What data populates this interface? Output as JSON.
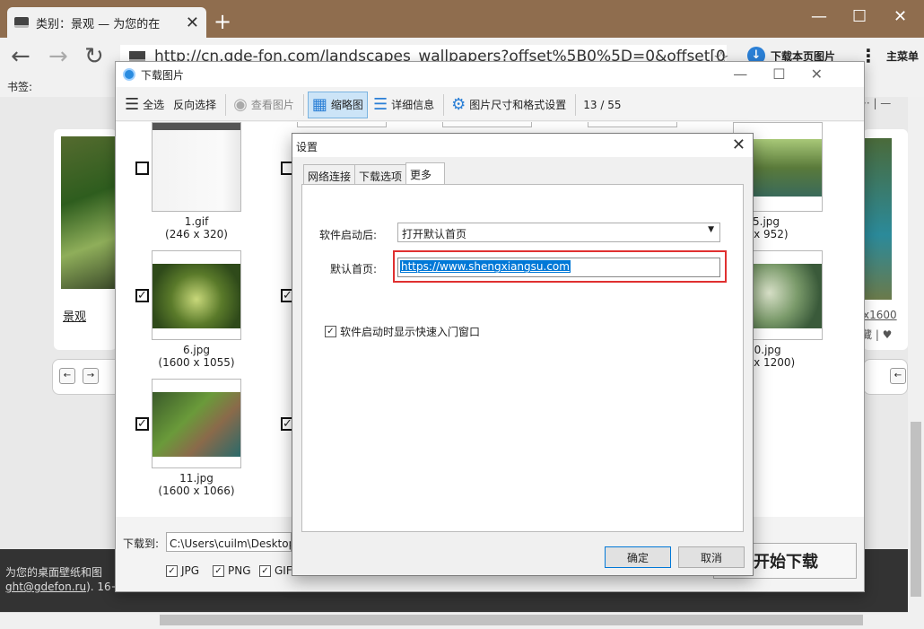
{
  "browser": {
    "tab_title": "类别：景观 — 为您的在",
    "tab_close": "✕",
    "new_tab": "+",
    "url": "http://cn.gde-fon.com/landscapes_wallpapers?offset%5B0%5D=0&offset[0]=27",
    "download_page_label": "下载本页图片",
    "main_menu_label": "主菜单",
    "bookmarks_label": "书签:",
    "icons": [
      "back-icon",
      "forward-icon",
      "reload-icon",
      "star-icon",
      "download-icon",
      "menu-icon",
      "minimize-icon",
      "maximize-icon",
      "close-icon"
    ]
  },
  "page": {
    "left_card_label": "景观",
    "right_card_label": "x1600",
    "right_card_meta": "藏 | ♥",
    "right_card_top": "·· | —",
    "footer_line1": "为您的桌面壁纸和图",
    "footer_line2_link": "ght@gdefon.ru",
    "footer_line2_rest": "). 16+"
  },
  "downloader": {
    "title": "下载图片",
    "toolbar": {
      "select_all": "全选",
      "invert": "反向选择",
      "view_image": "查看图片",
      "thumbnails": "缩略图",
      "details": "详细信息",
      "size_format": "图片尺寸和格式设置",
      "count": "13 / 55"
    },
    "images": [
      {
        "name": "1.gif",
        "size": "(246 x 320)"
      },
      {
        "name": "6.jpg",
        "size": "(1600 x 1055)"
      },
      {
        "name": "11.jpg",
        "size": "(1600 x 1066)"
      },
      {
        "name": "5.jpg",
        "size": "00 x 952)"
      },
      {
        "name": "10.jpg",
        "size": "00 x 1200)"
      }
    ],
    "download_to_label": "下载到:",
    "download_path": "C:\\Users\\cuilm\\Desktop\\花",
    "formats": [
      "JPG",
      "PNG",
      "GIF"
    ],
    "start_button": "开始下载"
  },
  "settings": {
    "title": "设置",
    "close": "✕",
    "tabs": [
      "网络连接",
      "下载选项",
      "更多"
    ],
    "active_tab": "更多",
    "startup_label": "软件启动后:",
    "startup_value": "打开默认首页",
    "homepage_label": "默认首页:",
    "homepage_value": "https://www.shengxiangsu.com",
    "show_quick_entry_label": "软件启动时显示快速入门窗口",
    "show_quick_entry_checked": true,
    "ok_button": "确定",
    "cancel_button": "取消"
  }
}
